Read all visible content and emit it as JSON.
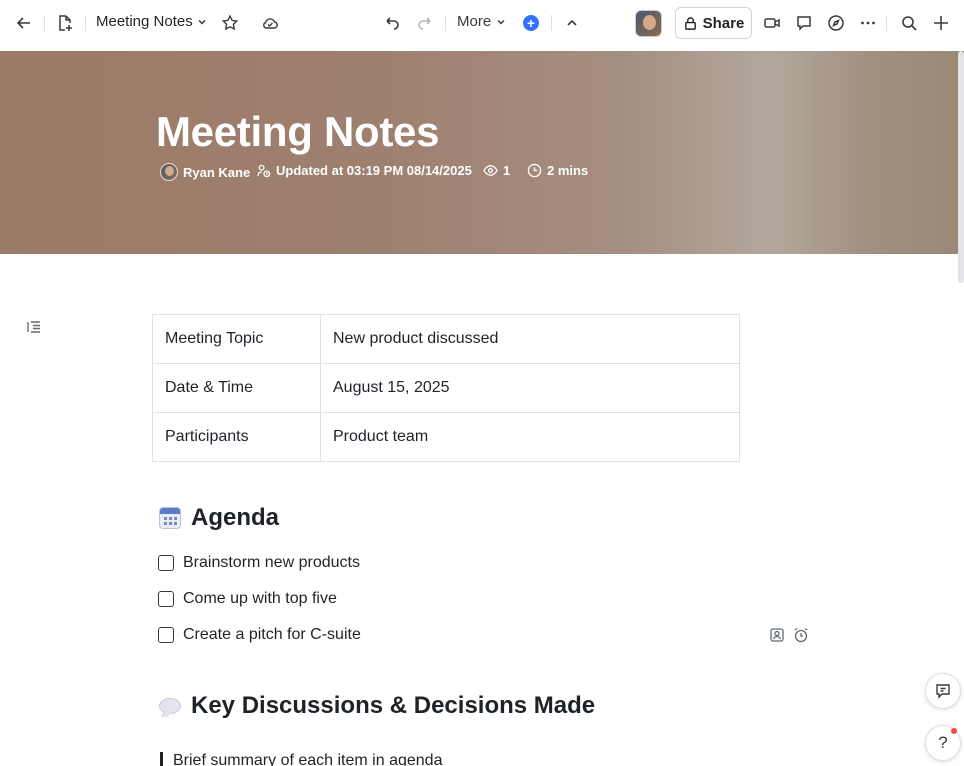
{
  "topbar": {
    "doc_title": "Meeting Notes",
    "more_label": "More",
    "share_label": "Share",
    "add_symbol": "+"
  },
  "banner": {
    "title": "Meeting Notes",
    "author": "Ryan Kane",
    "updated": "Updated at 03:19 PM 08/14/2025",
    "views": "1",
    "read_time": "2 mins"
  },
  "info_table": [
    {
      "key": "Meeting Topic",
      "value": "New product discussed"
    },
    {
      "key": "Date & Time",
      "value": "August 15, 2025"
    },
    {
      "key": "Participants",
      "value": "Product team"
    }
  ],
  "agenda": {
    "heading": "Agenda",
    "items": [
      "Brainstorm new products",
      "Come up with top five",
      "Create a pitch for C-suite"
    ]
  },
  "discussions": {
    "heading": "Key Discussions & Decisions Made",
    "quote": "Brief summary of each item in agenda"
  },
  "help_symbol": "?",
  "icons": [
    "back-arrow-icon",
    "new-doc-icon",
    "chevron-down-icon",
    "star-icon",
    "cloud-icon",
    "undo-icon",
    "redo-icon",
    "chevron-up-icon",
    "lock-icon",
    "video-icon",
    "comment-icon",
    "compass-icon",
    "more-dots-icon",
    "search-icon",
    "plus-icon",
    "outline-icon",
    "eye-icon",
    "clock-icon",
    "assign-icon",
    "alarm-icon",
    "feedback-icon"
  ],
  "colors": {
    "accent": "#3370ff",
    "banner": "#9e8070",
    "notification": "#f54a45"
  }
}
